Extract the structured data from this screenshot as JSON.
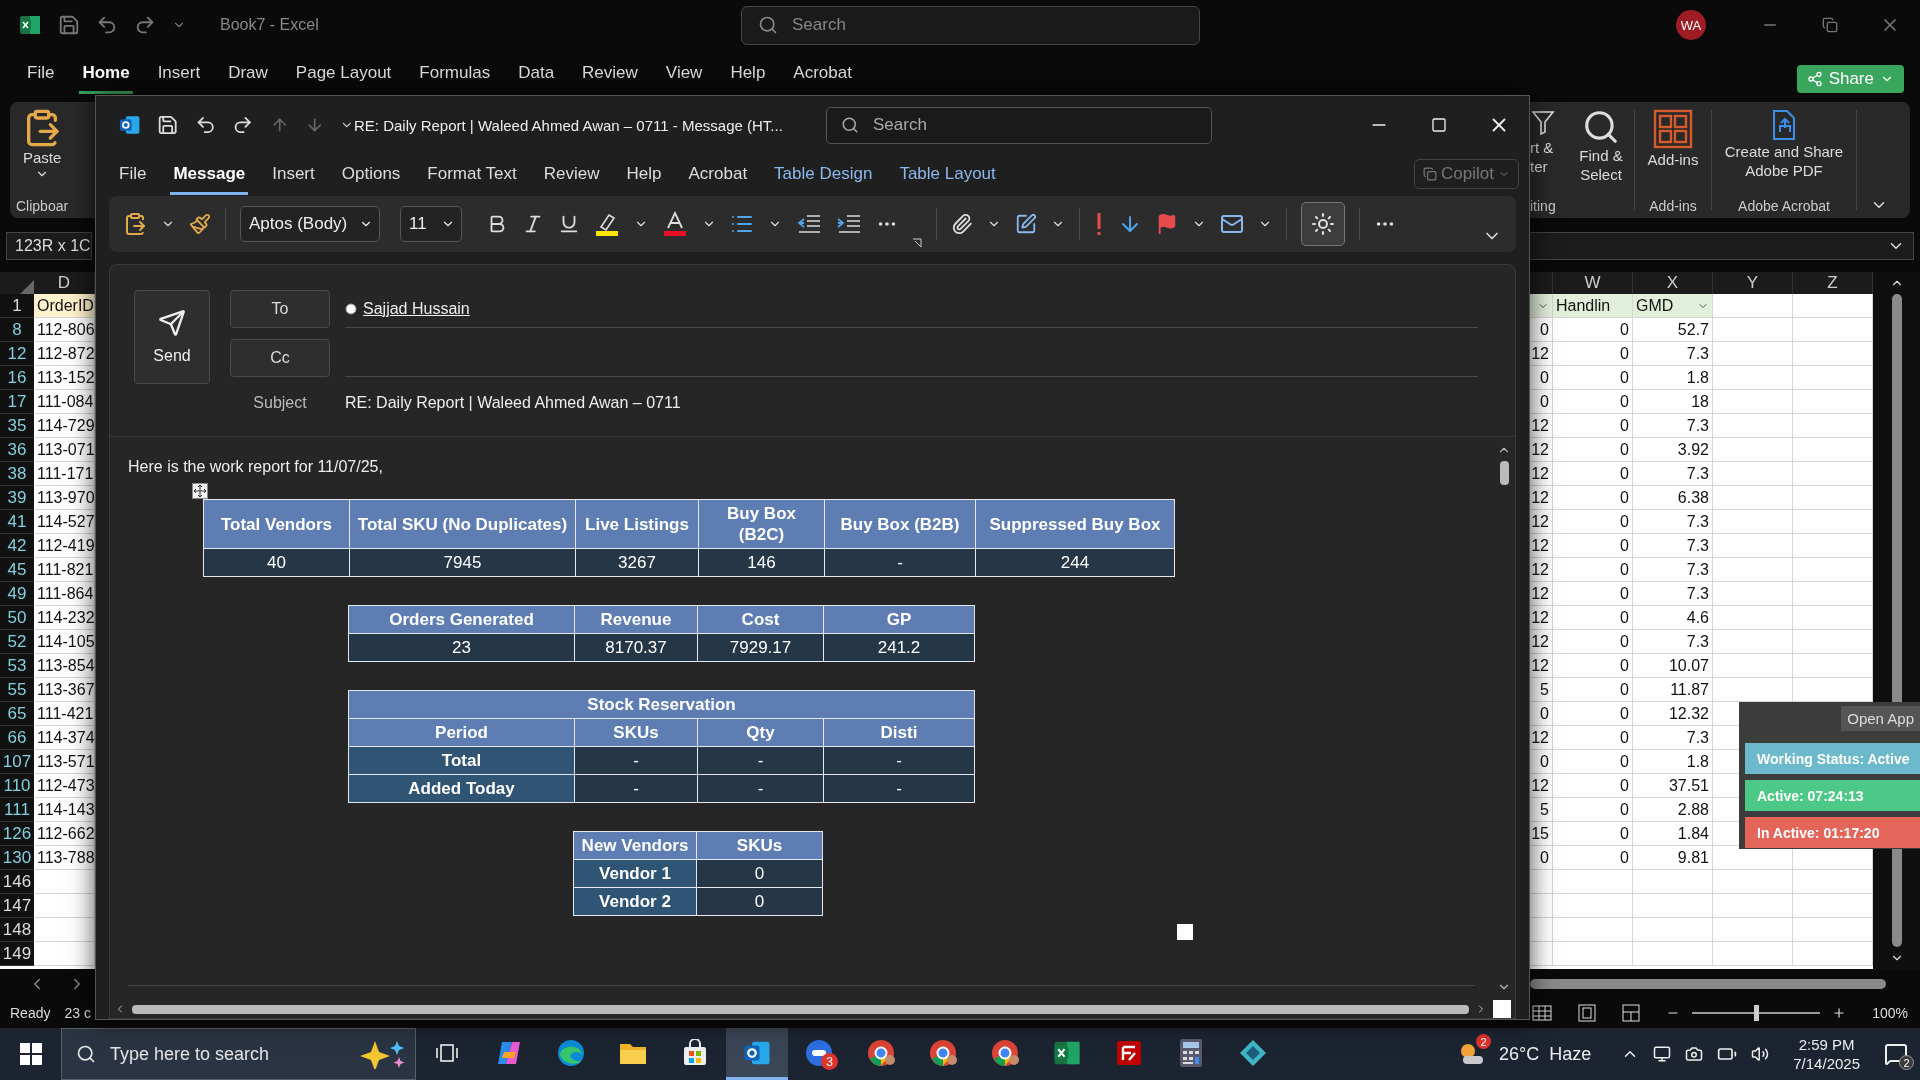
{
  "excel": {
    "title": "Book7  -  Excel",
    "search_placeholder": "Search",
    "avatar": "WA",
    "menu": [
      {
        "label": "File",
        "selected": false
      },
      {
        "label": "Home",
        "selected": true
      },
      {
        "label": "Insert",
        "selected": false
      },
      {
        "label": "Draw",
        "selected": false
      },
      {
        "label": "Page Layout",
        "selected": false
      },
      {
        "label": "Formulas",
        "selected": false
      },
      {
        "label": "Data",
        "selected": false
      },
      {
        "label": "Review",
        "selected": false
      },
      {
        "label": "View",
        "selected": false
      },
      {
        "label": "Help",
        "selected": false
      },
      {
        "label": "Acrobat",
        "selected": false
      }
    ],
    "share": "Share",
    "ribbon": {
      "paste": "Paste",
      "clipboard_group": "Clipboar",
      "sort_filter": [
        "rt &",
        "ter"
      ],
      "find_select": [
        "Find &",
        "Select"
      ],
      "editing_group": "iting",
      "addins": "Add-ins",
      "addins_group": "Add-ins",
      "acrobat": "Create and Share Adobe PDF",
      "acrobat_group": "Adobe Acrobat"
    },
    "name_box": "123R x 1C",
    "columns_left": [
      "D"
    ],
    "columns_right": [
      "W",
      "X",
      "Y",
      "Z"
    ],
    "header_row": {
      "number": "1",
      "order_id": "OrderID",
      "handling": "Handlin",
      "gmd": "GMD"
    },
    "rows": [
      {
        "number": "8",
        "order_id": "112-806",
        "column_v": "0",
        "handling": "0",
        "gmd": "52.7"
      },
      {
        "number": "12",
        "order_id": "112-872",
        "column_v": "12",
        "handling": "0",
        "gmd": "7.3"
      },
      {
        "number": "16",
        "order_id": "113-152",
        "column_v": "0",
        "handling": "0",
        "gmd": "1.8"
      },
      {
        "number": "17",
        "order_id": "111-084",
        "column_v": "0",
        "handling": "0",
        "gmd": "18"
      },
      {
        "number": "35",
        "order_id": "114-729",
        "column_v": "12",
        "handling": "0",
        "gmd": "7.3"
      },
      {
        "number": "36",
        "order_id": "113-071",
        "column_v": "12",
        "handling": "0",
        "gmd": "3.92"
      },
      {
        "number": "38",
        "order_id": "111-171",
        "column_v": "12",
        "handling": "0",
        "gmd": "7.3"
      },
      {
        "number": "39",
        "order_id": "113-970",
        "column_v": "12",
        "handling": "0",
        "gmd": "6.38"
      },
      {
        "number": "41",
        "order_id": "114-527",
        "column_v": "12",
        "handling": "0",
        "gmd": "7.3"
      },
      {
        "number": "42",
        "order_id": "112-419",
        "column_v": "12",
        "handling": "0",
        "gmd": "7.3"
      },
      {
        "number": "45",
        "order_id": "111-821",
        "column_v": "12",
        "handling": "0",
        "gmd": "7.3"
      },
      {
        "number": "49",
        "order_id": "111-864",
        "column_v": "12",
        "handling": "0",
        "gmd": "7.3"
      },
      {
        "number": "50",
        "order_id": "114-232",
        "column_v": "12",
        "handling": "0",
        "gmd": "4.6"
      },
      {
        "number": "52",
        "order_id": "114-105",
        "column_v": "12",
        "handling": "0",
        "gmd": "7.3"
      },
      {
        "number": "53",
        "order_id": "113-854",
        "column_v": "12",
        "handling": "0",
        "gmd": "10.07"
      },
      {
        "number": "55",
        "order_id": "113-367",
        "column_v": "5",
        "handling": "0",
        "gmd": "11.87"
      },
      {
        "number": "65",
        "order_id": "111-421",
        "column_v": "0",
        "handling": "0",
        "gmd": "12.32"
      },
      {
        "number": "66",
        "order_id": "114-374",
        "column_v": "12",
        "handling": "0",
        "gmd": "7.3"
      },
      {
        "number": "107",
        "order_id": "113-571",
        "column_v": "0",
        "handling": "0",
        "gmd": "1.8"
      },
      {
        "number": "110",
        "order_id": "112-473",
        "column_v": "12",
        "handling": "0",
        "gmd": "37.51"
      },
      {
        "number": "111",
        "order_id": "114-143",
        "column_v": "5",
        "handling": "0",
        "gmd": "2.88"
      },
      {
        "number": "126",
        "order_id": "112-662",
        "column_v": "15",
        "handling": "0",
        "gmd": "1.84"
      },
      {
        "number": "130",
        "order_id": "113-788",
        "column_v": "0",
        "handling": "0",
        "gmd": "9.81"
      }
    ],
    "empty_rows": [
      "146",
      "147",
      "148",
      "149"
    ],
    "status_bar": {
      "ready": "Ready",
      "count": "23 c",
      "zoom": {
        "reading": "100%",
        "level": 0.5
      }
    }
  },
  "outlook": {
    "title": "RE: Daily Report | Waleed Ahmed Awan – 0711  -  Message (HT...",
    "search_placeholder": "Search",
    "menu": [
      {
        "label": "File",
        "selected": false,
        "kind": "tab"
      },
      {
        "label": "Message",
        "selected": true,
        "kind": "tab"
      },
      {
        "label": "Insert",
        "selected": false,
        "kind": "tab"
      },
      {
        "label": "Options",
        "selected": false,
        "kind": "tab"
      },
      {
        "label": "Format Text",
        "selected": false,
        "kind": "tab"
      },
      {
        "label": "Review",
        "selected": false,
        "kind": "tab"
      },
      {
        "label": "Help",
        "selected": false,
        "kind": "tab"
      },
      {
        "label": "Acrobat",
        "selected": false,
        "kind": "tab"
      },
      {
        "label": "Table Design",
        "selected": false,
        "kind": "contextual"
      },
      {
        "label": "Table Layout",
        "selected": false,
        "kind": "contextual"
      }
    ],
    "copilot": "Copilot",
    "font": "Aptos (Body)",
    "size": "11",
    "background_toggle_on": true,
    "send": "Send",
    "to": "To",
    "cc": "Cc",
    "recipients": [
      "Sajjad Hussain"
    ],
    "subject_label": "Subject",
    "subject": "RE: Daily Report | Waleed Ahmed Awan – 0711",
    "body": {
      "greeting": "Here is the work report for 11/07/25,",
      "tables": [
        {
          "columns": [
            "Total Vendors",
            "Total SKU (No Duplicates)",
            "Live Listings",
            "Buy Box (B2C)",
            "Buy Box (B2B)",
            "Suppressed Buy Box"
          ],
          "rows": [
            [
              "40",
              "7945",
              "3267",
              "146",
              "-",
              "244"
            ]
          ],
          "row_headers": false
        },
        {
          "columns": [
            "Orders Generated",
            "Revenue",
            "Cost",
            "GP"
          ],
          "rows": [
            [
              "23",
              "8170.37",
              "7929.17",
              "241.2"
            ]
          ],
          "row_headers": false
        },
        {
          "title": "Stock Reservation",
          "columns": [
            "Period",
            "SKUs",
            "Qty",
            "Disti"
          ],
          "rows": [
            [
              "Total",
              "-",
              "-",
              "-"
            ],
            [
              "Added Today",
              "-",
              "-",
              "-"
            ]
          ],
          "row_headers": true
        },
        {
          "columns": [
            "New Vendors",
            "SKUs"
          ],
          "rows": [
            [
              "Vendor 1",
              "0"
            ],
            [
              "Vendor 2",
              "0"
            ]
          ],
          "row_headers": true
        }
      ]
    }
  },
  "tracker": {
    "open_app": "Open App",
    "items": [
      {
        "label": "Working Status: Active",
        "color": "#6cb9cb"
      },
      {
        "label": "Active: 07:24:13",
        "color": "#4cc987"
      },
      {
        "label": "In Active: 01:17:20",
        "color": "#e4665b"
      }
    ]
  },
  "taskbar": {
    "search_placeholder": "Type here to search",
    "apps": [
      {
        "kind": "taskview",
        "active": false
      },
      {
        "kind": "copilot",
        "active": false
      },
      {
        "kind": "edge",
        "active": false
      },
      {
        "kind": "folder",
        "active": false
      },
      {
        "kind": "store",
        "active": false
      },
      {
        "kind": "outlook",
        "active": true
      },
      {
        "kind": "bluecircle",
        "active": false,
        "badge": "3"
      },
      {
        "kind": "chrome",
        "active": false
      },
      {
        "kind": "chrome",
        "active": false
      },
      {
        "kind": "chrome",
        "active": false
      },
      {
        "kind": "excel",
        "active": false
      },
      {
        "kind": "redsquare",
        "active": false
      },
      {
        "kind": "calculator",
        "active": false
      },
      {
        "kind": "diamond",
        "active": false
      }
    ],
    "weather_badge": "2",
    "weather": "26°C  Haze",
    "time": "2:59 PM",
    "date": "7/14/2025",
    "notifications": "2"
  }
}
